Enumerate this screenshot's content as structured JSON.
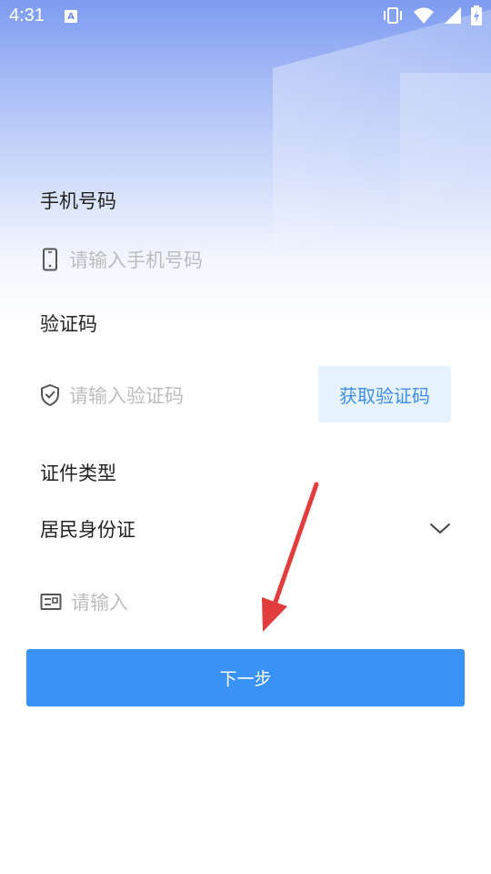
{
  "status_bar": {
    "time": "4:31",
    "notification_icon_letter": "A",
    "icons": [
      "vibrate-icon",
      "wifi-icon",
      "signal-icon",
      "battery-icon"
    ]
  },
  "form": {
    "phone": {
      "label": "手机号码",
      "placeholder": "请输入手机号码"
    },
    "code": {
      "label": "验证码",
      "placeholder": "请输入验证码",
      "get_code_button": "获取验证码"
    },
    "id_type": {
      "label": "证件类型",
      "selected": "居民身份证"
    },
    "id_number": {
      "placeholder": "请输入"
    },
    "next_button": "下一步"
  },
  "colors": {
    "primary": "#3a92f6",
    "get_code_bg": "#e6f2fd",
    "get_code_text": "#3f8ee8",
    "annotation_arrow": "#e23d3d",
    "header_gradient_top": "#7d9bf0"
  }
}
